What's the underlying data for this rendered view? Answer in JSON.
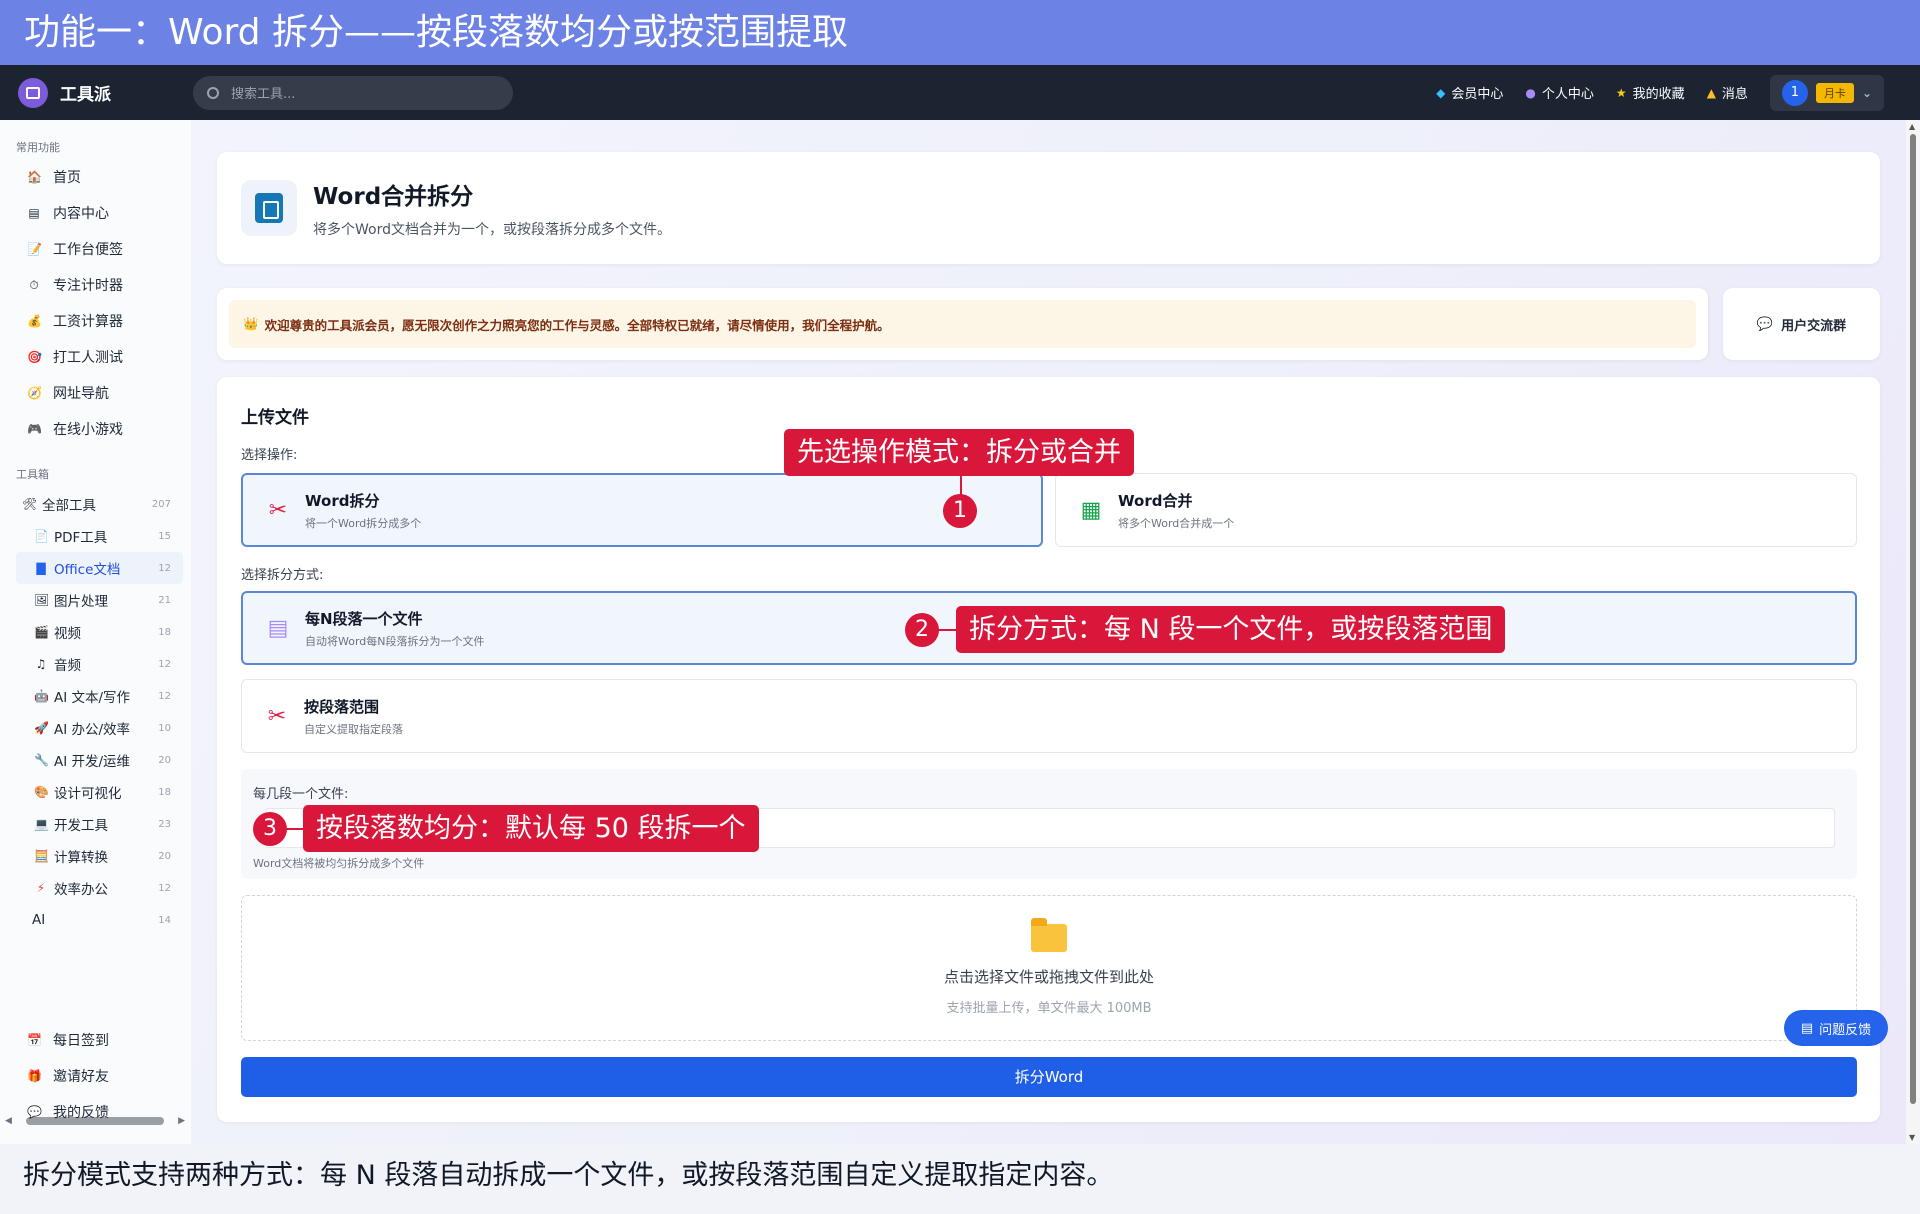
{
  "banner": {
    "title": "功能一：Word 拆分——按段落数均分或按范围提取"
  },
  "topbar": {
    "brand": "工具派",
    "search_placeholder": "搜索工具...",
    "links": [
      "会员中心",
      "个人中心",
      "我的收藏",
      "消息"
    ],
    "user_count": "1",
    "member_badge": "月卡"
  },
  "sidebar": {
    "common_heading": "常用功能",
    "common_items": [
      "首页",
      "内容中心",
      "工作台便签",
      "专注计时器",
      "工资计算器",
      "打工人测试",
      "网址导航",
      "在线小游戏"
    ],
    "toolbox_heading": "工具箱",
    "all_tools": {
      "label": "全部工具",
      "count": "207"
    },
    "tools": [
      {
        "label": "PDF工具",
        "count": "15"
      },
      {
        "label": "Office文档",
        "count": "12"
      },
      {
        "label": "图片处理",
        "count": "21"
      },
      {
        "label": "视频",
        "count": "18"
      },
      {
        "label": "音频",
        "count": "12"
      },
      {
        "label": "AI 文本/写作",
        "count": "12"
      },
      {
        "label": "AI 办公/效率",
        "count": "10"
      },
      {
        "label": "AI 开发/运维",
        "count": "20"
      },
      {
        "label": "设计可视化",
        "count": "18"
      },
      {
        "label": "开发工具",
        "count": "23"
      },
      {
        "label": "计算转换",
        "count": "20"
      },
      {
        "label": "效率办公",
        "count": "12"
      },
      {
        "label": "AI",
        "count": "14"
      }
    ],
    "bottom_items": [
      "每日签到",
      "邀请好友",
      "我的反馈"
    ]
  },
  "header": {
    "title": "Word合并拆分",
    "subtitle": "将多个Word文档合并为一个，或按段落拆分成多个文件。"
  },
  "welcome": {
    "text": "欢迎尊贵的工具派会员，愿无限次创作之力照亮您的工作与灵感。全部特权已就绪，请尽情使用，我们全程护航。"
  },
  "user_group": "用户交流群",
  "upload": {
    "title": "上传文件",
    "operation_label": "选择操作:",
    "operations": [
      {
        "title": "Word拆分",
        "desc": "将一个Word拆分成多个"
      },
      {
        "title": "Word合并",
        "desc": "将多个Word合并成一个"
      }
    ],
    "method_label": "选择拆分方式:",
    "methods": [
      {
        "title": "每N段落一个文件",
        "desc": "自动将Word每N段落拆分为一个文件"
      },
      {
        "title": "按段落范围",
        "desc": "自定义提取指定段落"
      }
    ],
    "param_label": "每几段一个文件:",
    "param_hint": "Word文档将被均匀拆分成多个文件",
    "drop_title": "点击选择文件或拖拽文件到此处",
    "drop_sub": "支持批量上传，单文件最大 100MB",
    "button": "拆分Word"
  },
  "feedback_button": "问题反馈",
  "callouts": [
    {
      "num": "1",
      "text": "先选操作模式：拆分或合并"
    },
    {
      "num": "2",
      "text": "拆分方式：每 N 段一个文件，或按段落范围"
    },
    {
      "num": "3",
      "text": "按段落数均分：默认每 50 段拆一个"
    }
  ],
  "caption": "拆分模式支持两种方式：每 N 段落自动拆成一个文件，或按段落范围自定义提取指定内容。",
  "colors": {
    "banner": "#6c82e4",
    "topbar": "#1c2331",
    "primary": "#1f5ee6",
    "callout": "#d9173b",
    "badge": "#f5b800"
  }
}
